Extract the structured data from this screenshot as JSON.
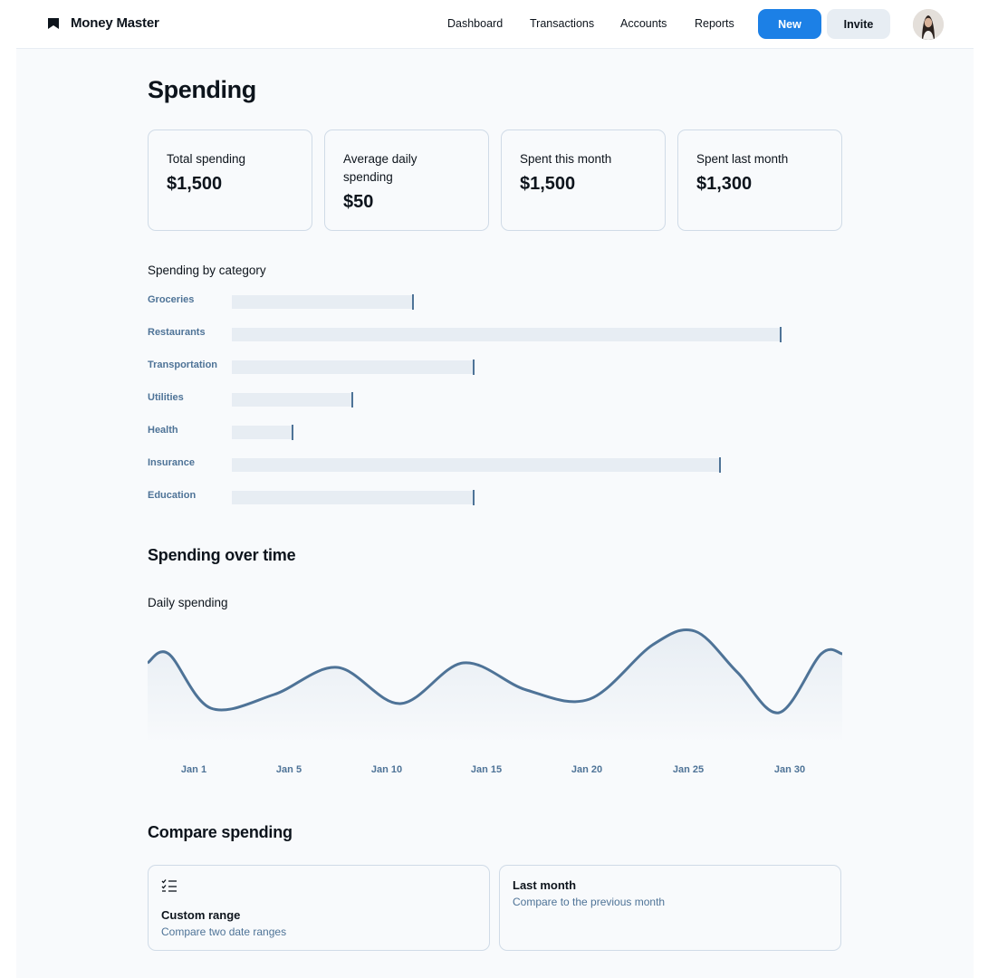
{
  "app": {
    "name": "Money Master"
  },
  "nav": [
    "Dashboard",
    "Transactions",
    "Accounts",
    "Reports"
  ],
  "buttons": {
    "new": "New",
    "invite": "Invite"
  },
  "page": {
    "title": "Spending"
  },
  "stats": [
    {
      "label": "Total spending",
      "value": "$1,500"
    },
    {
      "label": "Average daily spending",
      "value": "$50"
    },
    {
      "label": "Spent this month",
      "value": "$1,500"
    },
    {
      "label": "Spent last month",
      "value": "$1,300"
    }
  ],
  "by_category": {
    "title": "Spending by category",
    "items": [
      {
        "label": "Groceries",
        "fraction": 0.33
      },
      {
        "label": "Restaurants",
        "fraction": 1.0
      },
      {
        "label": "Transportation",
        "fraction": 0.44
      },
      {
        "label": "Utilities",
        "fraction": 0.22
      },
      {
        "label": "Health",
        "fraction": 0.11
      },
      {
        "label": "Insurance",
        "fraction": 0.89
      },
      {
        "label": "Education",
        "fraction": 0.44
      }
    ]
  },
  "over_time": {
    "heading": "Spending over time",
    "subtitle": "Daily spending"
  },
  "chart_data": {
    "type": "area",
    "x": [
      1,
      3,
      6,
      9,
      12,
      15,
      18,
      21,
      24,
      26,
      28,
      30,
      32
    ],
    "y": [
      90,
      30,
      45,
      75,
      35,
      80,
      50,
      40,
      100,
      115,
      70,
      25,
      90
    ],
    "x_ticks": [
      "Jan 1",
      "Jan 5",
      "Jan 10",
      "Jan 15",
      "Jan 20",
      "Jan 25",
      "Jan 30"
    ],
    "color": "#4e7397",
    "fill": "#e7edf3"
  },
  "compare": {
    "heading": "Compare spending",
    "cards": [
      {
        "title": "Custom range",
        "desc": "Compare two date ranges",
        "icon": "list-checks-icon"
      },
      {
        "title": "Last month",
        "desc": "Compare to the previous month"
      }
    ]
  },
  "colors": {
    "accent": "#1c80e6",
    "muted": "#4e7397",
    "border": "#d0dbe7",
    "track": "#e7edf3"
  }
}
